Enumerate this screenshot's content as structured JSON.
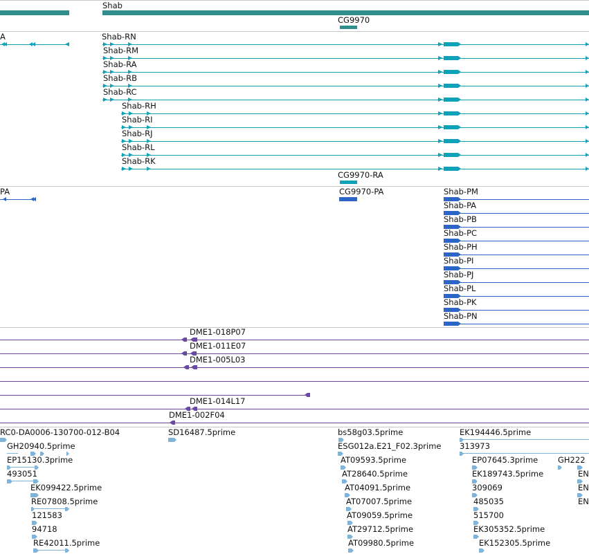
{
  "tracks": {
    "genes": {
      "label_left": "",
      "gene_label": "Shab",
      "cg_label": "CG9970",
      "color": "#2f8f8c"
    },
    "transcripts": {
      "cut_label": "A",
      "items": [
        "Shab-RN",
        "Shab-RM",
        "Shab-RA",
        "Shab-RB",
        "Shab-RC",
        "Shab-RH",
        "Shab-RI",
        "Shab-RJ",
        "Shab-RL",
        "Shab-RK"
      ],
      "cg_label": "CG9970-RA",
      "color": "#0fa1b8"
    },
    "proteins": {
      "cut_label": "PA",
      "cg_label": "CG9970-PA",
      "items": [
        "Shab-PM",
        "Shab-PA",
        "Shab-PB",
        "Shab-PC",
        "Shab-PH",
        "Shab-PI",
        "Shab-PJ",
        "Shab-PL",
        "Shab-PK",
        "Shab-PN"
      ],
      "color": "#2d64c8"
    },
    "clones": {
      "items": [
        "DME1-018P07",
        "DME1-011E07",
        "DME1-005L03",
        "DME1-014L17",
        "DME1-002F04"
      ],
      "color": "#6a4aa0"
    },
    "ests": {
      "color": "#7fb3d8",
      "labels": {
        "rc0": "RC0-DA0006-130700-012-B04",
        "gh20940": "GH20940.5prime",
        "ep15130": "EP15130.3prime",
        "n493051": "493051",
        "ek099422": "EK099422.5prime",
        "re07808": "RE07808.5prime",
        "n121583": "121583",
        "n94718": "94718",
        "re42011": "RE42011.5prime",
        "sd16487": "SD16487.5prime",
        "bs58g03": "bs58g03.5prime",
        "esg012a": "ESG012a.E21_F02.3prime",
        "at09593": "AT09593.5prime",
        "at28640": "AT28640.5prime",
        "at04091": "AT04091.5prime",
        "at07007": "AT07007.5prime",
        "at09059": "AT09059.5prime",
        "at29712": "AT29712.5prime",
        "at09980": "AT09980.5prime",
        "ek194446": "EK194446.5prime",
        "n313973": "313973",
        "ep07645": "EP07645.3prime",
        "ek189743": "EK189743.5prime",
        "n309069": "309069",
        "n485035": "485035",
        "n515700": "515700",
        "ek305352": "EK305352.5prime",
        "ek152305": "EK152305.5prime",
        "gh222": "GH222",
        "en1": "EN",
        "en2": "EN",
        "en3": "EN"
      }
    }
  }
}
